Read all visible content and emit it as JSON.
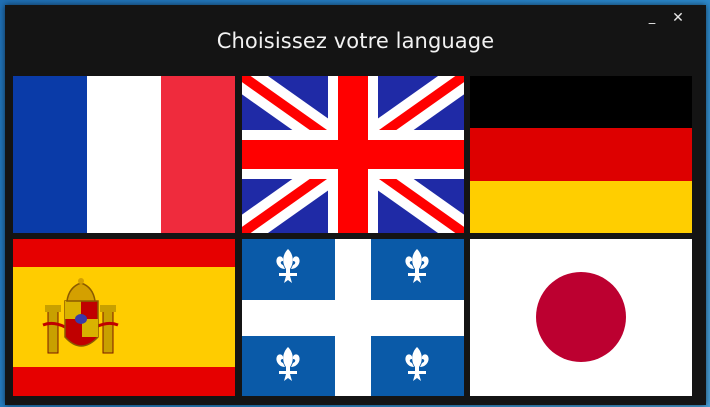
{
  "window": {
    "title": "Choisissez votre language",
    "minimize_glyph": "_",
    "close_glyph": "✕"
  },
  "flags": [
    {
      "id": "fr",
      "colors": [
        "#0a3ba8",
        "#ffffff",
        "#ef2b3d"
      ],
      "icon": "france-flag-icon"
    },
    {
      "id": "gb",
      "colors": [
        "#1f2aa6",
        "#ffffff",
        "#ff0000"
      ],
      "icon": "union-jack-flag-icon"
    },
    {
      "id": "de",
      "colors": [
        "#000000",
        "#dd0000",
        "#ffce00"
      ],
      "icon": "germany-flag-icon"
    },
    {
      "id": "es",
      "colors": [
        "#e60000",
        "#ffcc00"
      ],
      "icon": "spain-flag-icon"
    },
    {
      "id": "qc",
      "colors": [
        "#0a5aa8",
        "#ffffff"
      ],
      "icon": "quebec-flag-icon"
    },
    {
      "id": "jp",
      "colors": [
        "#ffffff",
        "#bc0030"
      ],
      "icon": "japan-flag-icon"
    }
  ]
}
